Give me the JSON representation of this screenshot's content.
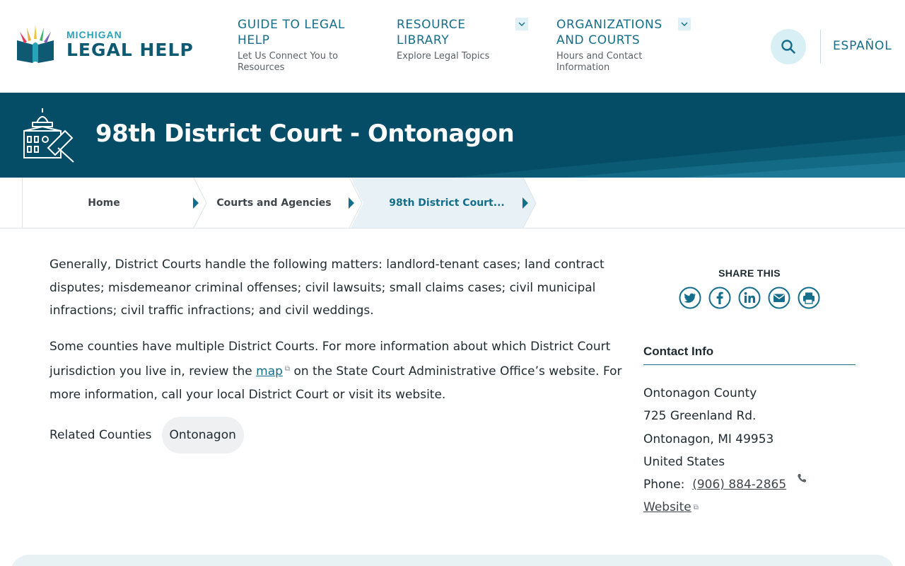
{
  "header": {
    "logo_small": "MICHIGAN",
    "logo_big": "LEGAL HELP",
    "nav": [
      {
        "title": "GUIDE TO LEGAL HELP",
        "subtitle": "Let Us Connect You to Resources"
      },
      {
        "title": "RESOURCE LIBRARY",
        "subtitle": "Explore Legal Topics"
      },
      {
        "title": "ORGANIZATIONS AND COURTS",
        "subtitle": "Hours and Contact Information"
      }
    ],
    "language": "ESPAÑOL"
  },
  "banner": {
    "title": "98th District Court - Ontonagon"
  },
  "breadcrumb": [
    {
      "label": "Home"
    },
    {
      "label": "Courts and Agencies"
    },
    {
      "label": "98th District Court..."
    }
  ],
  "content": {
    "para1": "Generally, District Courts handle the following matters: landlord-tenant cases; land contract disputes; misdemeanor criminal offenses; civil lawsuits; small claims cases; civil municipal infractions; civil traffic infractions; and civil weddings.",
    "para2_before": "Some counties have multiple District Courts. For more information about which District Court jurisdiction you live in, review the ",
    "para2_link": "map",
    "para2_after": " on the State Court Administrative Office’s website. For more information, call your local District Court or visit its website.",
    "related_label": "Related Counties",
    "related_counties": [
      "Ontonagon"
    ]
  },
  "sidebar": {
    "share_title": "SHARE THIS",
    "share_icons": [
      "twitter-icon",
      "facebook-icon",
      "linkedin-icon",
      "email-icon",
      "print-icon"
    ],
    "contact_title": "Contact Info",
    "address": [
      "Ontonagon County",
      "725 Greenland Rd.",
      "Ontonagon, MI 49953",
      "United States"
    ],
    "phone_label": "Phone:",
    "phone": "(906) 884-2865",
    "website_label": "Website"
  },
  "colors": {
    "banner_bg": "#054d66",
    "link": "#146e8c",
    "logo_teal": "#2aa3b9",
    "logo_navy": "#0e5a73"
  }
}
